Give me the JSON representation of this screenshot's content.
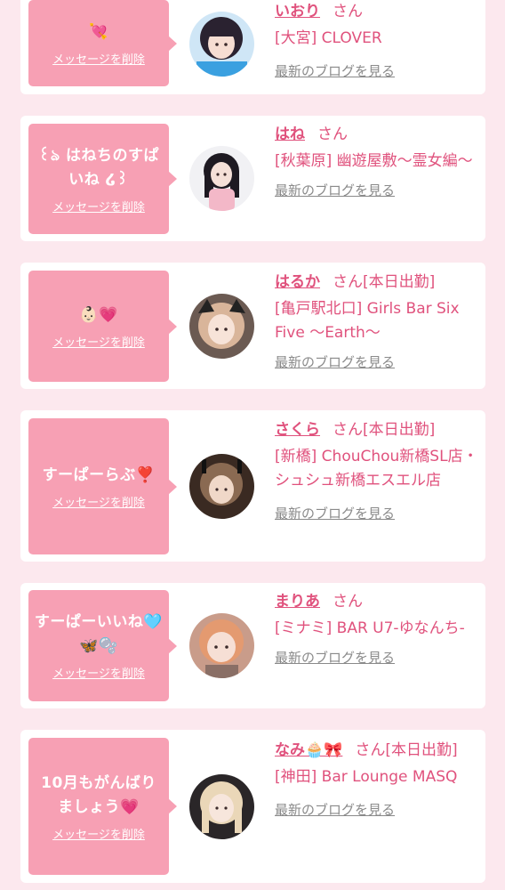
{
  "colors": {
    "page_bg": "#fce8ee",
    "card_bg": "#ffffff",
    "bubble_bg": "#f7a0b4",
    "accent_pink": "#e0527d",
    "muted_gray": "#8a8a8a"
  },
  "delete_label": "メッセージを削除",
  "blog_label": "最新のブログを見る",
  "entries": [
    {
      "message": "💘",
      "name": "いおり",
      "suffix": "さん",
      "shop": "[大宮] CLOVER",
      "avatar": "girl-avatar-1"
    },
    {
      "message": "꒰ঌ はねちのすぱいね ໒꒱",
      "name": "はね",
      "suffix": "さん",
      "shop": "[秋葉原] 幽遊屋敷〜霊女編〜",
      "avatar": "girl-avatar-2"
    },
    {
      "message": "👶🏻💗",
      "name": "はるか",
      "suffix": "さん[本日出勤]",
      "shop": "[亀戸駅北口] Girls Bar Six Five 〜Earth〜",
      "avatar": "girl-avatar-3"
    },
    {
      "message": "すーぱーらぶ❣️",
      "name": "さくら",
      "suffix": "さん[本日出勤]",
      "shop": "[新橋] ChouChou新橋SL店・シュシュ新橋エスエル店",
      "avatar": "girl-avatar-4"
    },
    {
      "message": "すーぱーいいね🩵🦋🫧",
      "name": "まりあ",
      "suffix": "さん",
      "shop": "[ミナミ] BAR U7-ゆなんち-",
      "avatar": "girl-avatar-5"
    },
    {
      "message": "10月もがんばりましょう💗",
      "name": "なみ🧁🎀",
      "suffix": "さん[本日出勤]",
      "shop": "[神田] Bar Lounge MASQ",
      "avatar": "girl-avatar-6"
    }
  ]
}
